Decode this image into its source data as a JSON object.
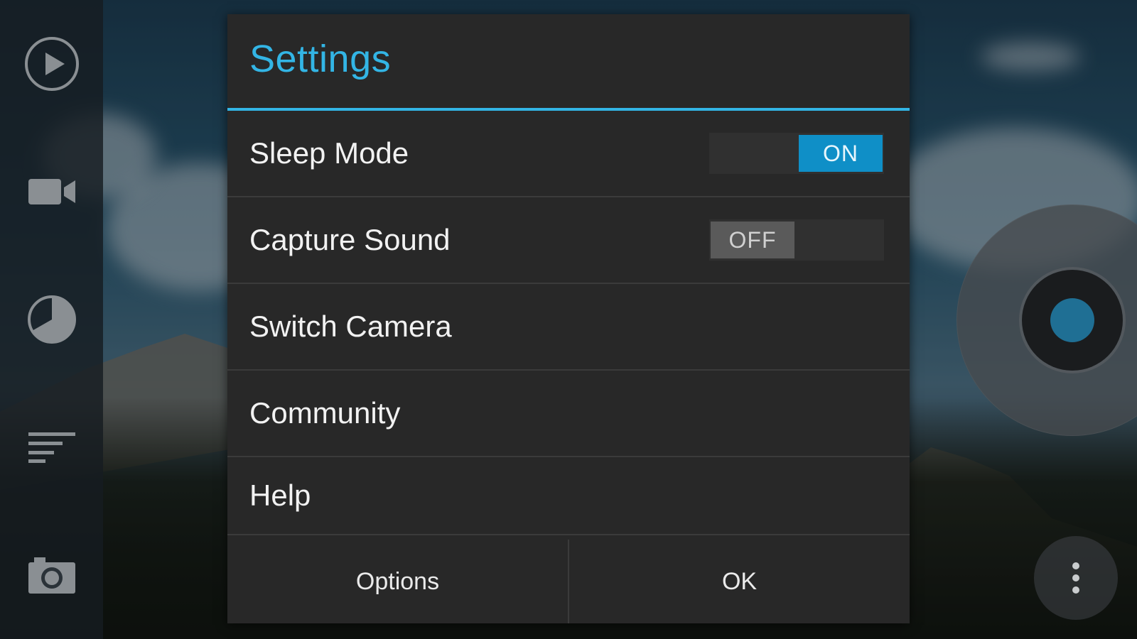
{
  "dialog": {
    "title": "Settings",
    "accent_color": "#33b5e5",
    "items": [
      {
        "label": "Sleep Mode",
        "toggle": {
          "state": "on",
          "text": "ON"
        }
      },
      {
        "label": "Capture Sound",
        "toggle": {
          "state": "off",
          "text": "OFF"
        }
      },
      {
        "label": "Switch Camera"
      },
      {
        "label": "Community"
      },
      {
        "label": "Help"
      }
    ],
    "buttons": {
      "options_label": "Options",
      "ok_label": "OK"
    }
  },
  "sidebar": {
    "items": [
      {
        "icon": "play-icon"
      },
      {
        "icon": "video-camera-icon"
      },
      {
        "icon": "timer-icon"
      },
      {
        "icon": "menu-lines-icon"
      },
      {
        "icon": "camera-icon"
      }
    ]
  },
  "shutter": {
    "icon": "shutter-button",
    "dot_color": "#1f6f94"
  },
  "overflow_menu": {
    "icon": "more-vert-icon"
  }
}
